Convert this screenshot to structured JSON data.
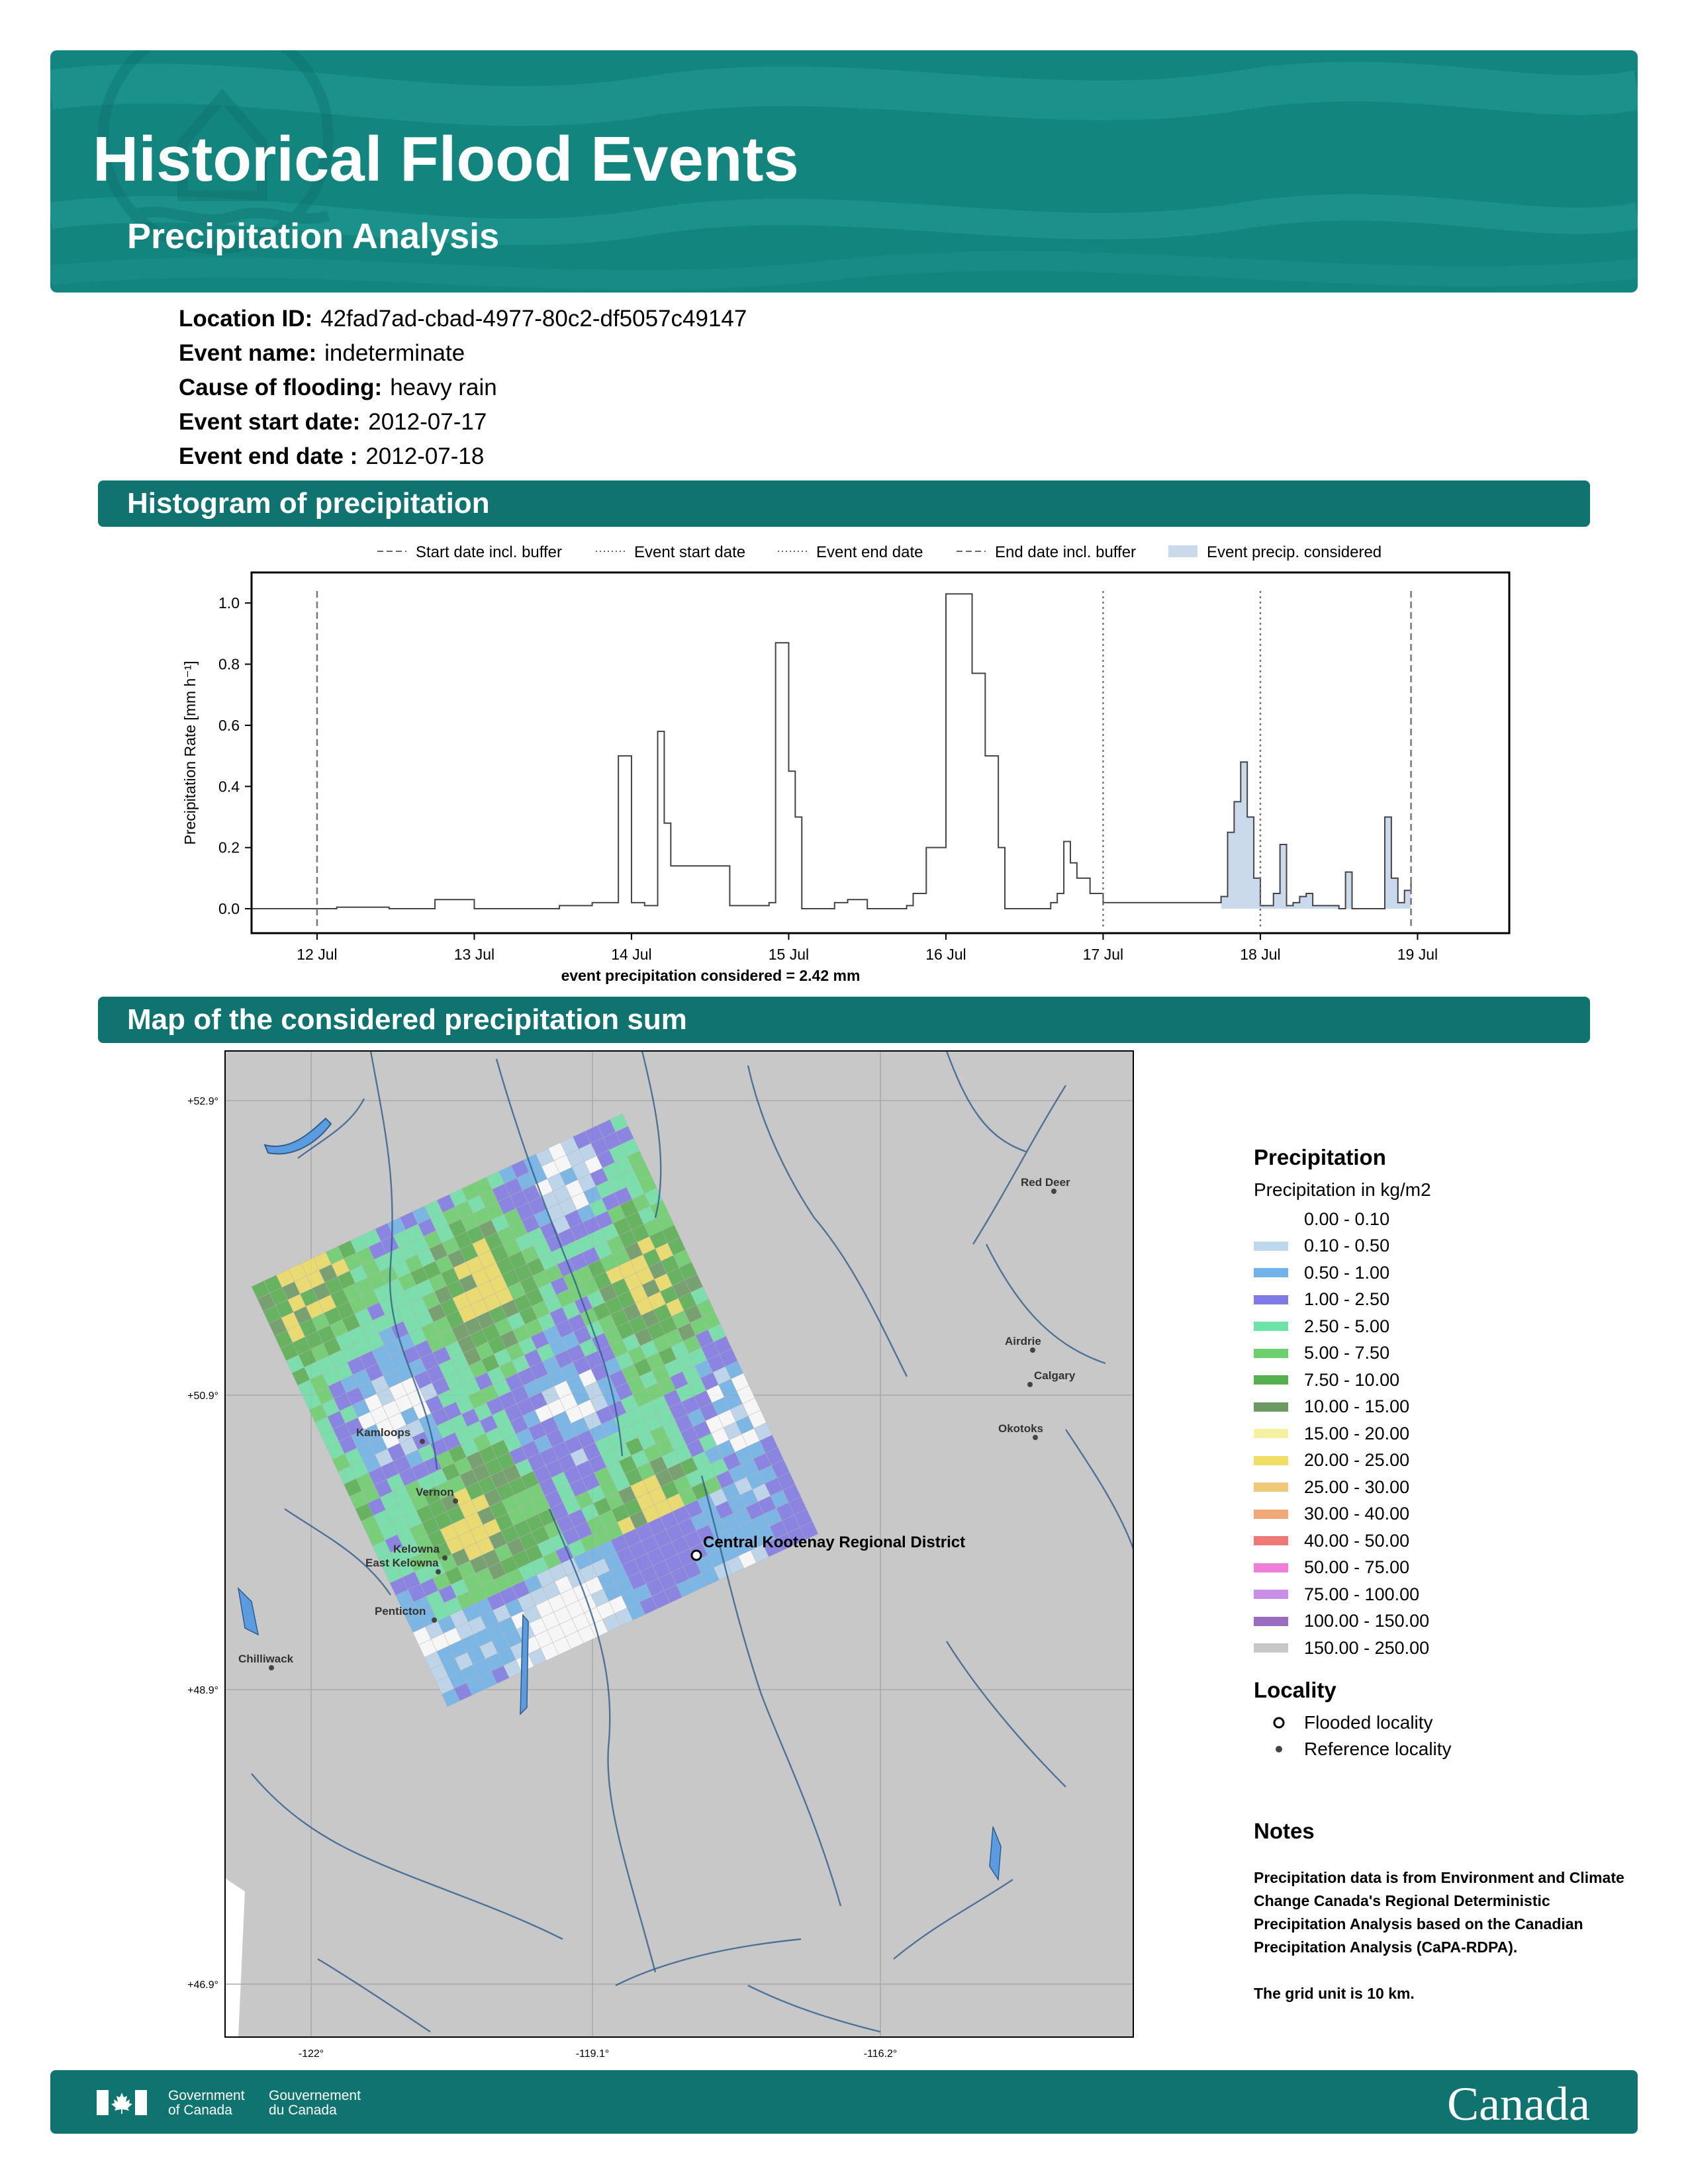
{
  "header": {
    "title": "Historical Flood Events",
    "subtitle": "Precipitation Analysis"
  },
  "meta": {
    "location_label": "Location ID:",
    "location_value": "42fad7ad-cbad-4977-80c2-df5057c49147",
    "event_name_label": "Event name:",
    "event_name_value": "indeterminate",
    "cause_label": "Cause of flooding:",
    "cause_value": "heavy rain",
    "start_label": "Event start date:",
    "start_value": "2012-07-17",
    "end_label": "Event end date :",
    "end_value": "2012-07-18"
  },
  "sections": {
    "histogram": "Histogram of precipitation",
    "map": "Map of the considered precipitation sum"
  },
  "chart_data": {
    "type": "line",
    "ylabel": "Precipitation Rate [mm h⁻¹]",
    "xlabel": "event precipitation considered = 2.42 mm",
    "xlim": [
      "2012-07-11T14:00",
      "2012-07-19T14:00"
    ],
    "ylim": [
      -0.08,
      1.1
    ],
    "x_ticks": [
      "12 Jul",
      "13 Jul",
      "14 Jul",
      "15 Jul",
      "16 Jul",
      "17 Jul",
      "18 Jul",
      "19 Jul"
    ],
    "x_tick_dates": [
      "2012-07-12T00:00",
      "2012-07-13T00:00",
      "2012-07-14T00:00",
      "2012-07-15T00:00",
      "2012-07-16T00:00",
      "2012-07-17T00:00",
      "2012-07-18T00:00",
      "2012-07-19T00:00"
    ],
    "y_ticks": [
      "0.0",
      "0.2",
      "0.4",
      "0.6",
      "0.8",
      "1.0"
    ],
    "y_tick_values": [
      0,
      0.2,
      0.4,
      0.6,
      0.8,
      1.0
    ],
    "legend": {
      "position": "top",
      "items": [
        {
          "label": "Start date incl. buffer",
          "style": "dashed"
        },
        {
          "label": "Event start date",
          "style": "dotted"
        },
        {
          "label": "Event end date",
          "style": "dotted"
        },
        {
          "label": "End date incl. buffer",
          "style": "dashed"
        },
        {
          "label": "Event precip. considered",
          "style": "fill"
        }
      ]
    },
    "vlines": [
      {
        "name": "Start date incl. buffer",
        "x": "2012-07-12T00:00",
        "style": "dashed"
      },
      {
        "name": "Event start date",
        "x": "2012-07-17T00:00",
        "style": "dotted"
      },
      {
        "name": "Event end date",
        "x": "2012-07-18T00:00",
        "style": "dotted"
      },
      {
        "name": "End date incl. buffer",
        "x": "2012-07-18T23:00",
        "style": "dashed"
      }
    ],
    "fill_range": [
      "2012-07-17T18:00",
      "2012-07-18T23:00"
    ],
    "series": [
      {
        "step": "post",
        "x": [
          "2012-07-12T00:00",
          "2012-07-12T03:00",
          "2012-07-12T11:00",
          "2012-07-12T18:00",
          "2012-07-13T00:00",
          "2012-07-13T03:00",
          "2012-07-13T13:00",
          "2012-07-13T18:00",
          "2012-07-13T20:00",
          "2012-07-13T22:00",
          "2012-07-14T00:00",
          "2012-07-14T02:00",
          "2012-07-14T03:00",
          "2012-07-14T04:00",
          "2012-07-14T05:00",
          "2012-07-14T06:00",
          "2012-07-14T07:00",
          "2012-07-14T08:00",
          "2012-07-14T11:00",
          "2012-07-14T15:00",
          "2012-07-14T18:00",
          "2012-07-14T21:00",
          "2012-07-14T22:00",
          "2012-07-15T00:00",
          "2012-07-15T01:00",
          "2012-07-15T02:00",
          "2012-07-15T03:00",
          "2012-07-15T04:00",
          "2012-07-15T05:00",
          "2012-07-15T07:00",
          "2012-07-15T09:00",
          "2012-07-15T12:00",
          "2012-07-15T13:00",
          "2012-07-15T14:00",
          "2012-07-15T15:00",
          "2012-07-15T18:00",
          "2012-07-15T19:00",
          "2012-07-15T21:00",
          "2012-07-16T00:00",
          "2012-07-16T04:00",
          "2012-07-16T06:00",
          "2012-07-16T08:00",
          "2012-07-16T09:00",
          "2012-07-16T10:00",
          "2012-07-16T11:00",
          "2012-07-16T12:00",
          "2012-07-16T13:00",
          "2012-07-16T14:00",
          "2012-07-16T15:00",
          "2012-07-16T16:00",
          "2012-07-16T17:00",
          "2012-07-16T18:00",
          "2012-07-16T19:00",
          "2012-07-16T20:00",
          "2012-07-16T22:00",
          "2012-07-17T00:00",
          "2012-07-17T18:00",
          "2012-07-17T19:00",
          "2012-07-17T20:00",
          "2012-07-17T21:00",
          "2012-07-17T22:00",
          "2012-07-17T23:00",
          "2012-07-18T00:00",
          "2012-07-18T01:00",
          "2012-07-18T02:00",
          "2012-07-18T03:00",
          "2012-07-18T04:00",
          "2012-07-18T05:00",
          "2012-07-18T06:00",
          "2012-07-18T07:00",
          "2012-07-18T08:00",
          "2012-07-18T09:00",
          "2012-07-18T10:00",
          "2012-07-18T11:00",
          "2012-07-18T12:00",
          "2012-07-18T13:00",
          "2012-07-18T14:00",
          "2012-07-18T15:00",
          "2012-07-18T16:00",
          "2012-07-18T17:00",
          "2012-07-18T18:00",
          "2012-07-18T19:00",
          "2012-07-18T20:00",
          "2012-07-18T21:00",
          "2012-07-18T22:00",
          "2012-07-18T23:00"
        ],
        "y": [
          0.0,
          0.005,
          0.0,
          0.03,
          0.0,
          0.0,
          0.01,
          0.02,
          0.02,
          0.5,
          0.02,
          0.01,
          0.01,
          0.58,
          0.28,
          0.14,
          0.14,
          0.14,
          0.14,
          0.01,
          0.01,
          0.02,
          0.87,
          0.45,
          0.3,
          0.0,
          0.0,
          0.0,
          0.0,
          0.02,
          0.03,
          0.0,
          0.0,
          0.0,
          0.0,
          0.01,
          0.05,
          0.2,
          1.03,
          0.77,
          0.5,
          0.2,
          0.0,
          0.0,
          0.0,
          0.0,
          0.0,
          0.0,
          0.0,
          0.02,
          0.05,
          0.22,
          0.15,
          0.1,
          0.05,
          0.02,
          0.04,
          0.25,
          0.35,
          0.48,
          0.3,
          0.1,
          0.01,
          0.01,
          0.05,
          0.21,
          0.01,
          0.02,
          0.04,
          0.05,
          0.01,
          0.01,
          0.01,
          0.01,
          0.0,
          0.12,
          0.0,
          0.0,
          0.0,
          0.0,
          0.0,
          0.3,
          0.1,
          0.02,
          0.06,
          0.1
        ]
      }
    ]
  },
  "map": {
    "lat_labels": [
      "+52.9°",
      "+50.9°",
      "+48.9°",
      "+46.9°"
    ],
    "lon_labels": [
      "-122°",
      "-119.1°",
      "-116.2°"
    ],
    "flooded_locality": "Central Kootenay Regional District",
    "reference_localities": [
      "Red Deer",
      "Airdrie",
      "Calgary",
      "Okotoks",
      "Kamloops",
      "Vernon",
      "Kelowna",
      "East Kelowna",
      "Penticton",
      "Chilliwack"
    ]
  },
  "legend": {
    "title": "Precipitation",
    "subtitle": "Precipitation in kg/m2",
    "classes": [
      {
        "label": "0.00 - 0.10",
        "color": "#ffffff"
      },
      {
        "label": "0.10 - 0.50",
        "color": "#bdd7ee"
      },
      {
        "label": "0.50 - 1.00",
        "color": "#6fb3ea"
      },
      {
        "label": "1.00 - 2.50",
        "color": "#7f7ae6"
      },
      {
        "label": "2.50 - 5.00",
        "color": "#6ee3a8"
      },
      {
        "label": "5.00 - 7.50",
        "color": "#6cd06c"
      },
      {
        "label": "7.50 - 10.00",
        "color": "#57b050"
      },
      {
        "label": "10.00 - 15.00",
        "color": "#6c9a62"
      },
      {
        "label": "15.00 - 20.00",
        "color": "#f4f2a0"
      },
      {
        "label": "20.00 - 25.00",
        "color": "#f1de64"
      },
      {
        "label": "25.00 - 30.00",
        "color": "#f0c87a"
      },
      {
        "label": "30.00 - 40.00",
        "color": "#f0a878"
      },
      {
        "label": "40.00 - 50.00",
        "color": "#ec7878"
      },
      {
        "label": "50.00 - 75.00",
        "color": "#ee7fd8"
      },
      {
        "label": "75.00 - 100.00",
        "color": "#c98ee6"
      },
      {
        "label": "100.00 - 150.00",
        "color": "#9a6cc2"
      },
      {
        "label": "150.00 - 250.00",
        "color": "#c8c8c8"
      }
    ],
    "locality_title": "Locality",
    "flooded_label": "Flooded locality",
    "reference_label": "Reference locality"
  },
  "notes": {
    "title": "Notes",
    "text1": "Precipitation data is from Environment and Climate Change Canada's Regional Deterministic Precipitation Analysis based on the Canadian Precipitation Analysis (CaPA-RDPA).",
    "text2": "The grid unit is 10 km."
  },
  "footer": {
    "gov_en_1": "Government",
    "gov_en_2": "of Canada",
    "gov_fr_1": "Gouvernement",
    "gov_fr_2": "du Canada",
    "wordmark": "Canada"
  }
}
